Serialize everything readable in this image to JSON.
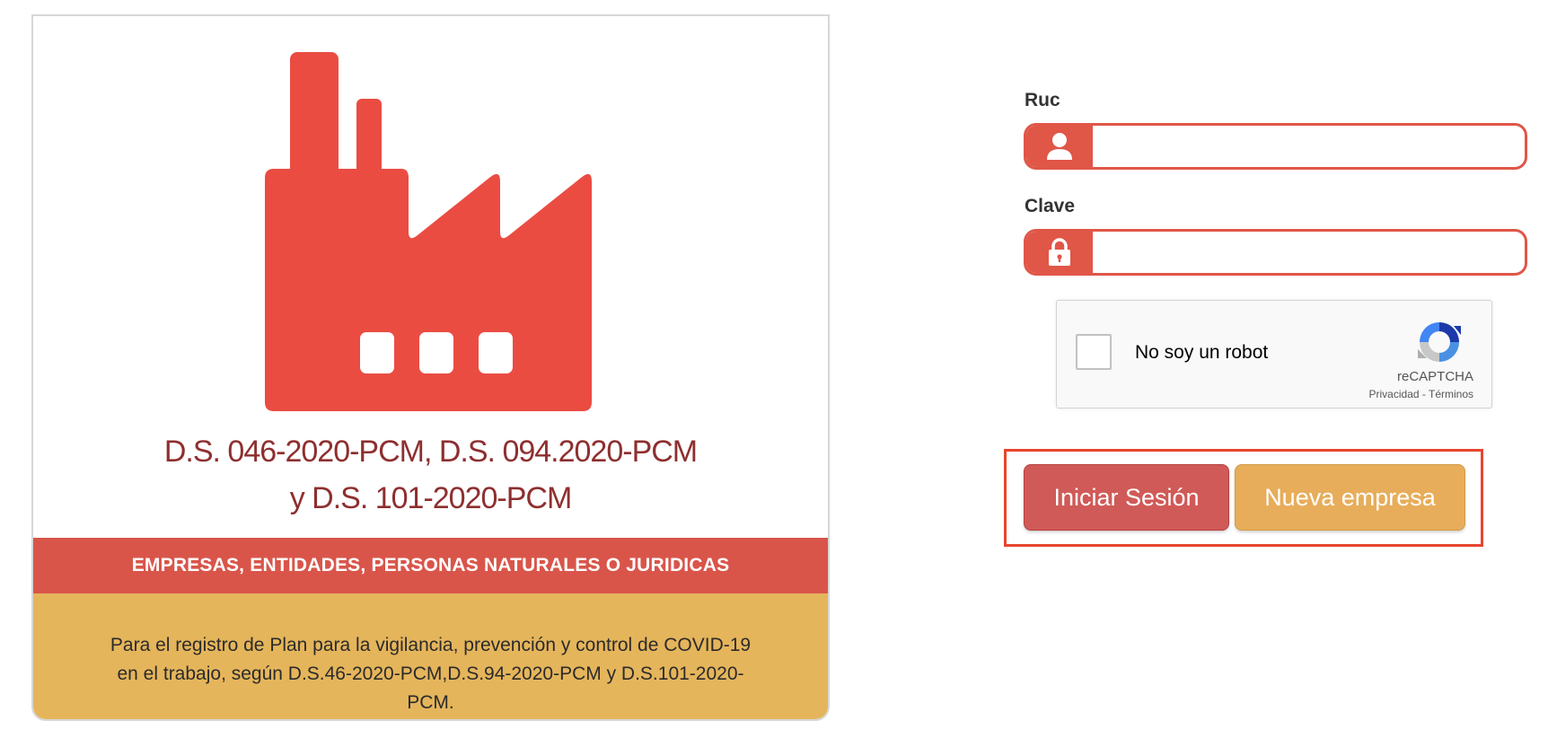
{
  "card": {
    "decree_line1": "D.S. 046-2020-PCM, D.S. 094.2020-PCM",
    "decree_line2": "y D.S. 101-2020-PCM",
    "banner": "EMPRESAS, ENTIDADES, PERSONAS NATURALES O JURIDICAS",
    "description_lines": [
      "Para el registro de Plan para la vigilancia, prevención y control de COVID-19",
      "en el trabajo, según D.S.46-2020-PCM,D.S.94-2020-PCM y D.S.101-2020-",
      "PCM."
    ],
    "illustration_icon": "factory-icon"
  },
  "form": {
    "ruc_label": "Ruc",
    "ruc_value": "",
    "ruc_icon": "user-icon",
    "clave_label": "Clave",
    "clave_value": "",
    "clave_icon": "lock-icon"
  },
  "recaptcha": {
    "label": "No soy un robot",
    "brand": "reCAPTCHA",
    "links": "Privacidad - Términos",
    "checked": false
  },
  "buttons": {
    "login": "Iniciar Sesión",
    "new_company": "Nueva empresa"
  },
  "colors": {
    "primary_red": "#e05647",
    "banner_red": "#d9554a",
    "accent_yellow": "#e5b55b",
    "decree_text": "#8e2f2f"
  }
}
